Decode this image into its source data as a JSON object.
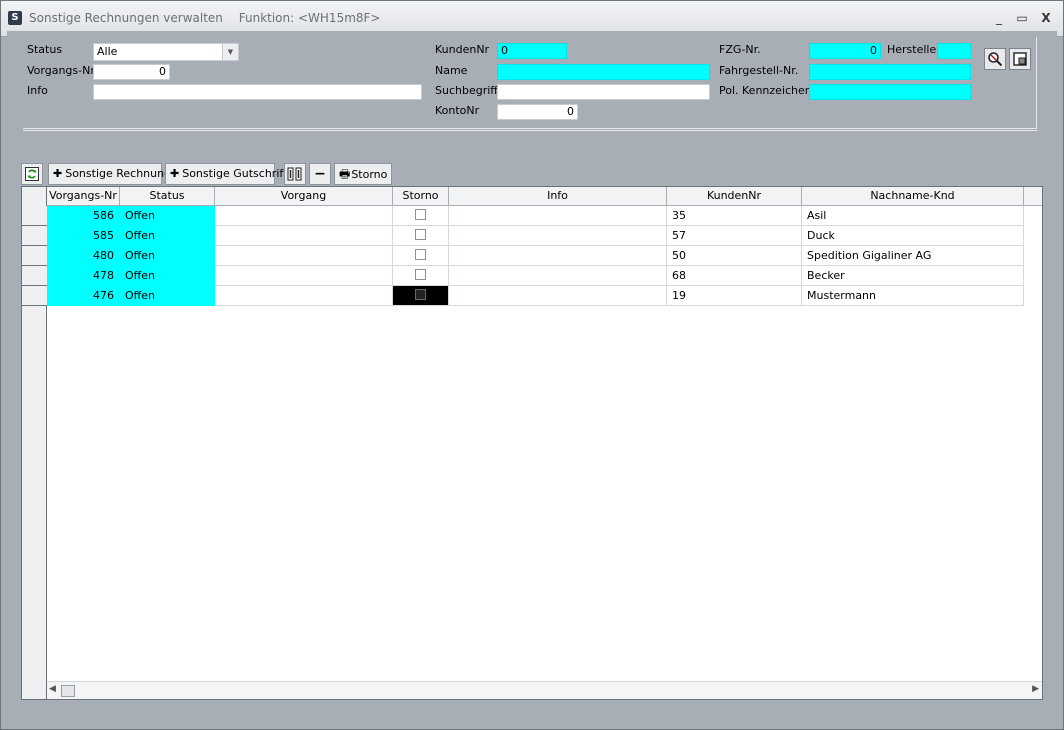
{
  "window": {
    "title": "Sonstige Rechnungen verwalten",
    "function": "Funktion: <WH15m8F>",
    "minimize": "_",
    "maximize": "▭",
    "close": "X"
  },
  "filters": {
    "status_label": "Status",
    "status_value": "Alle",
    "vorgangsnr_label": "Vorgangs-Nr",
    "vorgangsnr_value": "0",
    "info_label": "Info",
    "info_value": "",
    "kundennr_label": "KundenNr",
    "kundennr_value": "0",
    "name_label": "Name",
    "name_value": "",
    "suchbegriff_label": "Suchbegriff",
    "suchbegriff_value": "",
    "kontonr_label": "KontoNr",
    "kontonr_value": "0",
    "fzgnr_label": "FZG-Nr.",
    "fzgnr_value": "0",
    "hersteller_label": "Hersteller",
    "hersteller_value": "",
    "fahrgestell_label": "Fahrgestell-Nr.",
    "fahrgestell_value": "",
    "kennzeichen_label": "Pol. Kennzeichen",
    "kennzeichen_value": ""
  },
  "toolbar": {
    "sonstige_rechnung": "Sonstige Rechnung",
    "sonstige_gutschrift": "Sonstige Gutschrift",
    "storno": "Storno"
  },
  "colors": {
    "highlight": "#00ffff"
  },
  "grid": {
    "columns": [
      "Vorgangs-Nr",
      "Status",
      "Vorgang",
      "Storno",
      "Info",
      "KundenNr",
      "Nachname-Knd"
    ],
    "rows": [
      {
        "vorgangsnr": "586",
        "status": "Offen",
        "vorgang": "",
        "info": "",
        "kundennr": "35",
        "nachname": "Asil"
      },
      {
        "vorgangsnr": "585",
        "status": "Offen",
        "vorgang": "",
        "info": "",
        "kundennr": "57",
        "nachname": "Duck"
      },
      {
        "vorgangsnr": "480",
        "status": "Offen",
        "vorgang": "",
        "info": "",
        "kundennr": "50",
        "nachname": "Spedition Gigaliner AG"
      },
      {
        "vorgangsnr": "478",
        "status": "Offen",
        "vorgang": "",
        "info": "",
        "kundennr": "68",
        "nachname": "Becker"
      },
      {
        "vorgangsnr": "476",
        "status": "Offen",
        "vorgang": "",
        "info": "",
        "kundennr": "19",
        "nachname": "Mustermann"
      }
    ]
  }
}
